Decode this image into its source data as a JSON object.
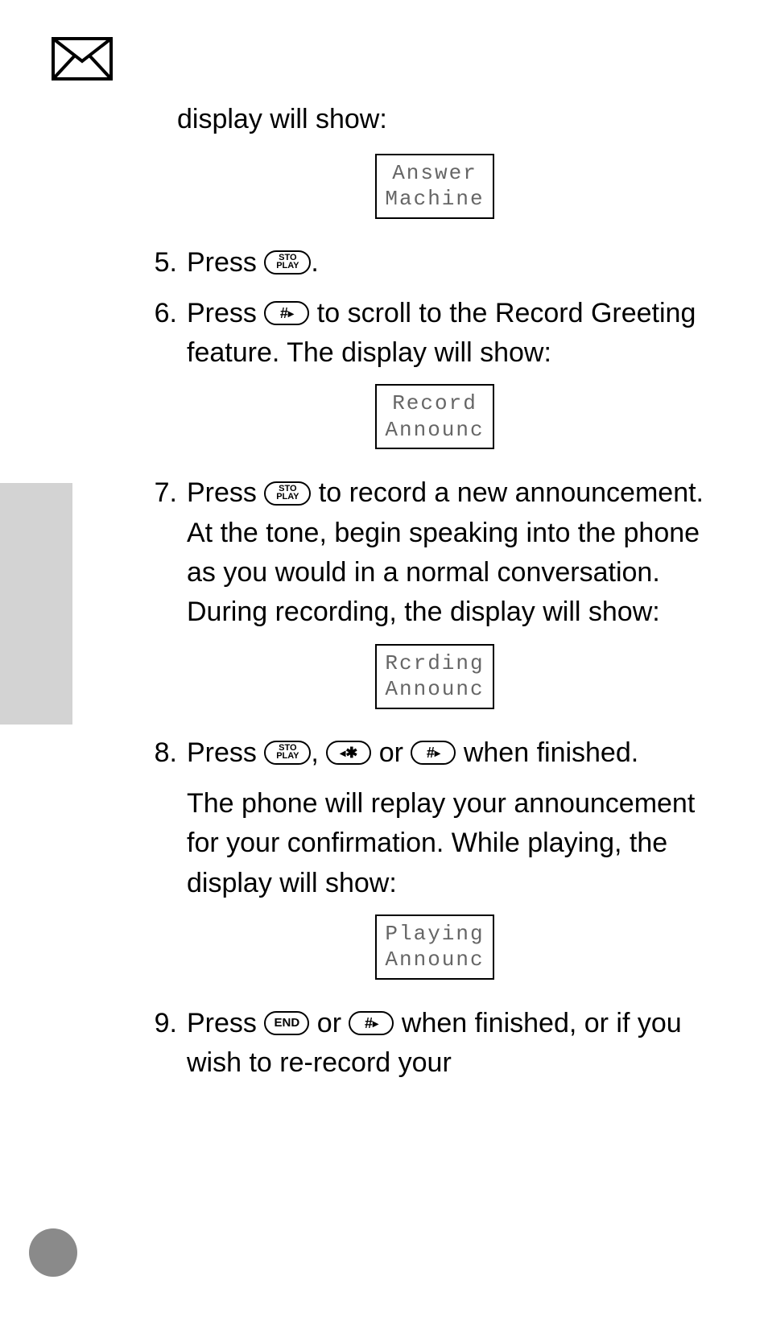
{
  "header": {
    "icon": "envelope-icon"
  },
  "intro": "display will show:",
  "displays": {
    "d1": {
      "line1": "Answer",
      "line2": "Machine"
    },
    "d2": {
      "line1": "Record",
      "line2": "Announc"
    },
    "d3": {
      "line1": "Rcrding",
      "line2": "Announc"
    },
    "d4": {
      "line1": "Playing",
      "line2": "Announc"
    }
  },
  "keys": {
    "sto": "STO",
    "play": "PLAY",
    "hash": "#",
    "star": "✱",
    "end": "END"
  },
  "steps": {
    "s5": {
      "num": "5.",
      "t1": "Press ",
      "t2": "."
    },
    "s6": {
      "num": "6.",
      "t1": "Press ",
      "t2": " to scroll to the Record Greeting feature. The display will show:"
    },
    "s7": {
      "num": "7.",
      "t1": "Press ",
      "t2": " to record a new announcement. At the tone, begin speaking into the phone as you would in a normal conversation. During recording, the display will show:"
    },
    "s8": {
      "num": "8.",
      "t1": "Press ",
      "t2": ", ",
      "t3": " or ",
      "t4": " when finished."
    },
    "s8_follow": "The phone will replay your announcement for your confirmation. While playing, the display will show:",
    "s9": {
      "num": "9.",
      "t1": "Press ",
      "t2": " or ",
      "t3": " when finished, or if you wish to re-record your"
    }
  }
}
